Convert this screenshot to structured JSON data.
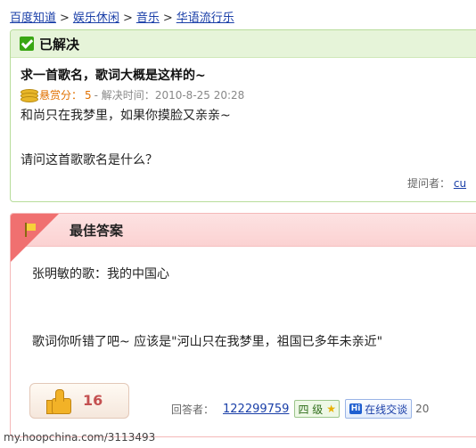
{
  "breadcrumb": [
    "百度知道",
    "娱乐休闲",
    "音乐",
    "华语流行乐"
  ],
  "question": {
    "status": "已解决",
    "title": "求一首歌名，歌词大概是这样的~",
    "reward_label": "悬赏分：",
    "reward_value": "5",
    "resolved_label": "- 解决时间：",
    "resolved_time": "2010-8-25 20:28",
    "body_line1": "和尚只在我梦里，如果你摸脸又亲亲~",
    "body_line2": "请问这首歌歌名是什么？",
    "asker_label": "提问者：",
    "asker_name": "cu"
  },
  "answer": {
    "header": "最佳答案",
    "line1": "张明敏的歌：我的中国心",
    "line2": "歌词你听错了吧~  应该是\"河山只在我梦里，祖国已多年未亲近\"",
    "like_count": "16",
    "answerer_label": "回答者：",
    "answerer_name": "122299759",
    "level": "四 级",
    "chat_label": "在线交谈",
    "date_fragment": "20"
  },
  "watermark": "my.hoopchina.com/3113493"
}
